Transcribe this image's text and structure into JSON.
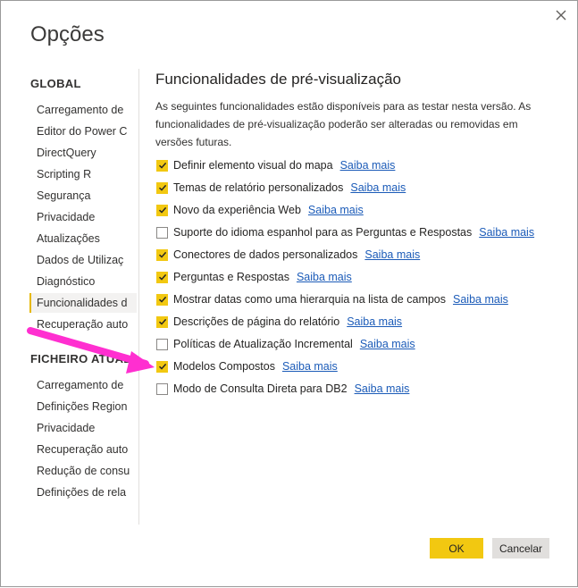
{
  "dialog": {
    "title": "Opções"
  },
  "sidebar": {
    "global_header": "GLOBAL",
    "global_items": [
      {
        "label": "Carregamento de"
      },
      {
        "label": "Editor do Power C"
      },
      {
        "label": "DirectQuery"
      },
      {
        "label": "Scripting R"
      },
      {
        "label": "Segurança"
      },
      {
        "label": "Privacidade"
      },
      {
        "label": "Atualizações"
      },
      {
        "label": "Dados de Utilizaç"
      },
      {
        "label": "Diagnóstico"
      },
      {
        "label": "Funcionalidades d"
      },
      {
        "label": "Recuperação auto"
      }
    ],
    "active_index": 9,
    "current_header": "FICHEIRO ATUAL",
    "current_items": [
      {
        "label": "Carregamento de"
      },
      {
        "label": "Definições Region"
      },
      {
        "label": "Privacidade"
      },
      {
        "label": "Recuperação auto"
      },
      {
        "label": "Redução de consu"
      },
      {
        "label": "Definições de rela"
      }
    ]
  },
  "main": {
    "title": "Funcionalidades de pré-visualização",
    "description": "As seguintes funcionalidades estão disponíveis para as testar nesta versão. As funcionalidades de pré-visualização poderão ser alteradas ou removidas em versões futuras.",
    "features": [
      {
        "label": "Definir elemento visual do mapa",
        "checked": true,
        "link": "Saiba mais"
      },
      {
        "label": "Temas de relatório personalizados",
        "checked": true,
        "link": "Saiba mais"
      },
      {
        "label": "Novo da experiência Web",
        "checked": true,
        "link": "Saiba mais"
      },
      {
        "label": "Suporte do idioma espanhol para as Perguntas e Respostas",
        "checked": false,
        "link": "Saiba mais"
      },
      {
        "label": "Conectores de dados personalizados",
        "checked": true,
        "link": "Saiba mais"
      },
      {
        "label": "Perguntas e Respostas",
        "checked": true,
        "link": "Saiba mais"
      },
      {
        "label": "Mostrar datas como uma hierarquia na lista de campos",
        "checked": true,
        "link": "Saiba mais"
      },
      {
        "label": "Descrições de página do relatório",
        "checked": true,
        "link": "Saiba mais"
      },
      {
        "label": "Políticas de Atualização Incremental",
        "checked": false,
        "link": "Saiba mais"
      },
      {
        "label": "Modelos Compostos",
        "checked": true,
        "link": "Saiba mais"
      },
      {
        "label": "Modo de Consulta Direta para DB2",
        "checked": false,
        "link": "Saiba mais"
      }
    ]
  },
  "buttons": {
    "ok_label": "OK",
    "cancel_label": "Cancelar"
  },
  "icons": {
    "close": "close-icon",
    "check": "checkmark-icon",
    "annotation": "arrow-annotation"
  },
  "colors": {
    "accent": "#f2c811",
    "link": "#1b5bb8",
    "arrow": "#ff2fd0"
  }
}
